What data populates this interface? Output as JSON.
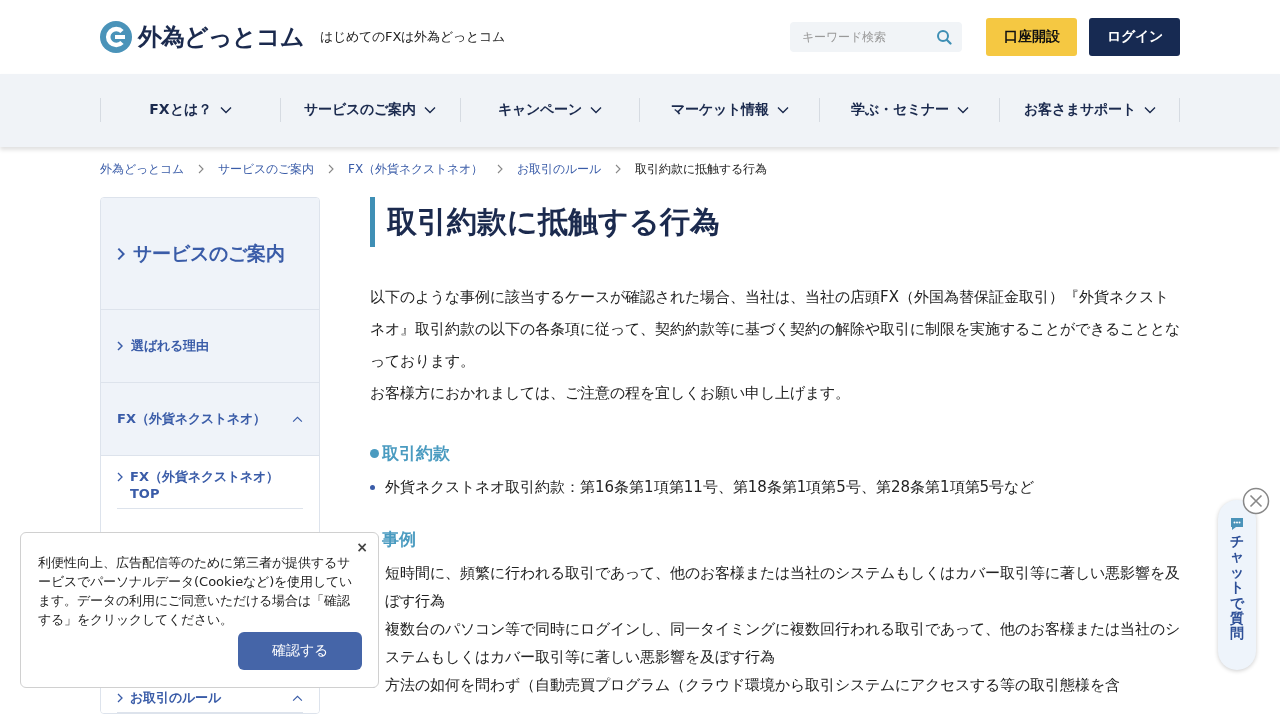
{
  "header": {
    "logo_text": "外為どっとコム",
    "tagline": "はじめてのFXは外為どっとコム",
    "search": {
      "placeholder": "キーワード検索"
    },
    "buttons": [
      {
        "label": "口座開設",
        "kind": "primary"
      },
      {
        "label": "ログイン",
        "kind": "dark"
      }
    ]
  },
  "nav": [
    {
      "label": "FXとは？"
    },
    {
      "label": "サービスのご案内"
    },
    {
      "label": "キャンペーン"
    },
    {
      "label": "マーケット情報"
    },
    {
      "label": "学ぶ・セミナー"
    },
    {
      "label": "お客さまサポート"
    }
  ],
  "breadcrumb": [
    "外為どっとコム",
    "サービスのご案内",
    "FX（外貨ネクストネオ）",
    "お取引のルール",
    "取引約款に抵触する行為"
  ],
  "sidebar": {
    "title": "サービスのご案内",
    "items": [
      {
        "label": "選ばれる理由"
      },
      {
        "label": "FX（外貨ネクストネオ）",
        "expanded": true,
        "children": [
          {
            "label": "FX（外貨ネクストネオ）TOP"
          },
          {
            "label": "お取引のルール",
            "expanded": true
          }
        ]
      }
    ]
  },
  "main": {
    "title": "取引約款に抵触する行為",
    "intro": [
      "以下のような事例に該当するケースが確認された場合、当社は、当社の店頭FX（外国為替保証金取引）『外貨ネクストネオ』取引約款の以下の各条項に従って、契約約款等に基づく契約の解除や取引に制限を実施することができることとなっております。",
      "お客様方におかれましては、ご注意の程を宜しくお願い申し上げます。"
    ],
    "sections": [
      {
        "heading": "取引約款",
        "items": [
          "外貨ネクストネオ取引約款：第16条第1項第11号、第18条第1項第5号、第28条第1項第5号など"
        ]
      },
      {
        "heading": "事例",
        "items": [
          "短時間に、頻繁に行われる取引であって、他のお客様または当社のシステムもしくはカバー取引等に著しい悪影響を及ぼす行為",
          "複数台のパソコン等で同時にログインし、同一タイミングに複数回行われる取引であって、他のお客様または当社のシステムもしくはカバー取引等に著しい悪影響を及ぼす行為",
          "方法の如何を問わず（自動売買プログラム（クラウド環境から取引システムにアクセスする等の取引態様を含"
        ]
      }
    ]
  },
  "cookie": {
    "close": "×",
    "text": "利便性向上、広告配信等のために第三者が提供するサービスでパーソナルデータ(Cookieなど)を使用しています。データの利用にご同意いただける場合は「確認する」をクリックしてください。",
    "button": "確認する"
  },
  "chat": {
    "label": "チャットで質問"
  }
}
